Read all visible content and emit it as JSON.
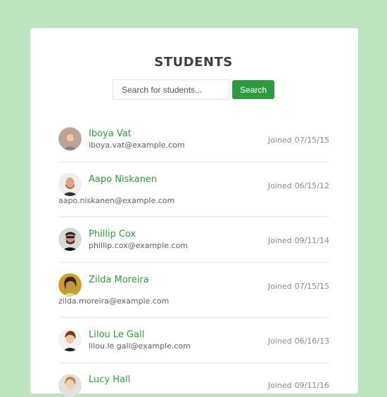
{
  "header": {
    "title": "STUDENTS"
  },
  "search": {
    "placeholder": "Search for students...",
    "button_label": "Search"
  },
  "joined_prefix": "Joined",
  "students": [
    {
      "name": "Iboya Vat",
      "email": "iboya.vat@example.com",
      "joined": "07/15/15"
    },
    {
      "name": "Aapo Niskanen",
      "email": "aapo.niskanen@example.com",
      "joined": "06/15/12"
    },
    {
      "name": "Phillip Cox",
      "email": "phillip.cox@example.com",
      "joined": "09/11/14"
    },
    {
      "name": "Zilda Moreira",
      "email": "zilda.moreira@example.com",
      "joined": "07/15/15"
    },
    {
      "name": "Lilou Le Gall",
      "email": "lilou.le gall@example.com",
      "joined": "06/16/13"
    },
    {
      "name": "Lucy Hall",
      "email": "",
      "joined": "09/11/16"
    }
  ]
}
